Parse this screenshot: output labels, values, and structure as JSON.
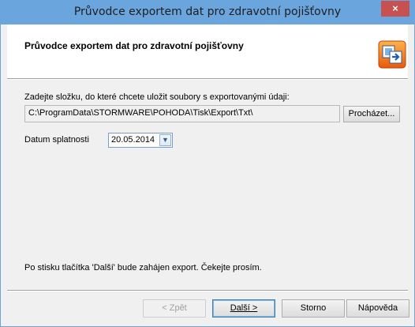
{
  "window": {
    "title": "Průvodce exportem dat pro zdravotní pojišťovny",
    "close_glyph": "×"
  },
  "header": {
    "title": "Průvodce exportem dat pro zdravotní pojišťovny",
    "icon": "export-wizard-icon"
  },
  "content": {
    "folder_label": "Zadejte složku, do které chcete uložit soubory s exportovanými údaji:",
    "folder_path": "C:\\ProgramData\\STORMWARE\\POHODA\\Tisk\\Export\\Txt\\",
    "browse_button": "Procházet...",
    "due_date_label": "Datum splatnosti",
    "due_date_value": "20.05.2014",
    "info_text": "Po stisku tlačítka 'Další' bude zahájen export. Čekejte prosím."
  },
  "buttons": {
    "back": "< Zpět",
    "next": "Další >",
    "cancel": "Storno",
    "help": "Nápověda"
  },
  "colors": {
    "titlebar": "#6aa5de",
    "close": "#c75050",
    "dialog_bg": "#f0f0f0"
  }
}
